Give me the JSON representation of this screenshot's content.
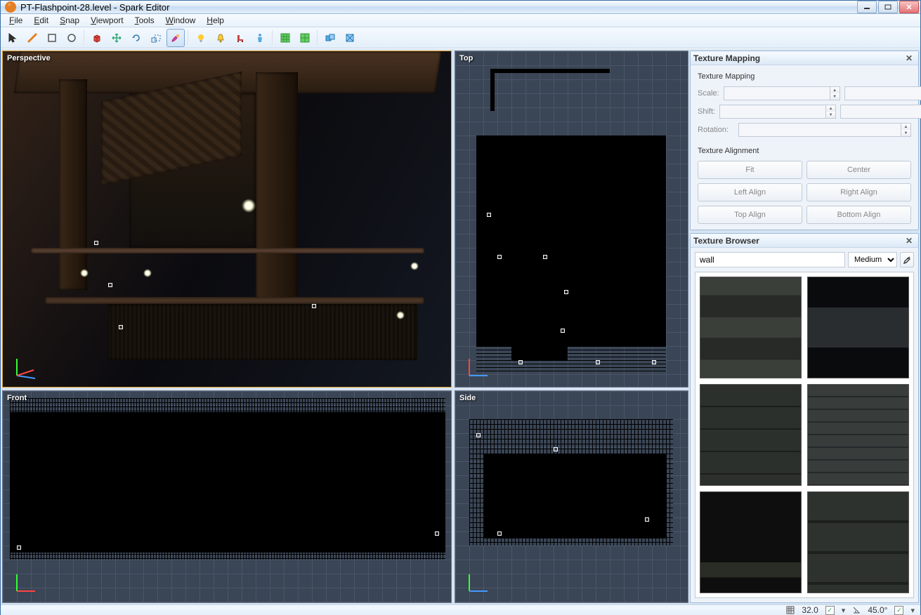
{
  "window": {
    "title": "PT-Flashpoint-28.level - Spark Editor"
  },
  "menu": [
    "File",
    "Edit",
    "Snap",
    "Viewport",
    "Tools",
    "Window",
    "Help"
  ],
  "toolbar": {
    "items": [
      {
        "name": "select-tool",
        "icon": "cursor"
      },
      {
        "name": "line-tool",
        "icon": "pencil"
      },
      {
        "name": "rect-tool",
        "icon": "rect"
      },
      {
        "name": "circle-tool",
        "icon": "circle"
      },
      {
        "name": "extrude-tool",
        "icon": "extrude"
      },
      {
        "name": "move-tool",
        "icon": "move"
      },
      {
        "name": "rotate-tool",
        "icon": "rotate"
      },
      {
        "name": "scale-tool",
        "icon": "scale"
      },
      {
        "name": "paint-tool",
        "icon": "paint",
        "active": true
      },
      {
        "name": "light-tool",
        "icon": "light"
      },
      {
        "name": "spawn-tool",
        "icon": "bell"
      },
      {
        "name": "prop-tool",
        "icon": "chair"
      },
      {
        "name": "player-tool",
        "icon": "player"
      },
      {
        "name": "grid-major",
        "icon": "gridA"
      },
      {
        "name": "grid-minor",
        "icon": "gridB"
      },
      {
        "name": "group-tool",
        "icon": "group"
      },
      {
        "name": "face-tool",
        "icon": "face"
      }
    ]
  },
  "viewports": {
    "perspective": {
      "label": "Perspective"
    },
    "top": {
      "label": "Top"
    },
    "front": {
      "label": "Front"
    },
    "side": {
      "label": "Side"
    }
  },
  "texture_mapping": {
    "title": "Texture Mapping",
    "group": "Texture Mapping",
    "scale_label": "Scale:",
    "shift_label": "Shift:",
    "rotation_label": "Rotation:",
    "align_group": "Texture Alignment",
    "buttons": {
      "fit": "Fit",
      "center": "Center",
      "left": "Left Align",
      "right": "Right Align",
      "top": "Top Align",
      "bottom": "Bottom Align"
    }
  },
  "texture_browser": {
    "title": "Texture Browser",
    "search": "wall",
    "size": "Medium",
    "thumbs": [
      {
        "c1": "#3a3f3a",
        "c2": "#272a27",
        "pattern": "panel"
      },
      {
        "c1": "#1a1c20",
        "c2": "#0a0b0d",
        "pattern": "band"
      },
      {
        "c1": "#2c302c",
        "c2": "#1b1e1b",
        "pattern": "tile"
      },
      {
        "c1": "#383c3a",
        "c2": "#24282a",
        "pattern": "brick"
      },
      {
        "c1": "#0e0e0e",
        "c2": "#2a2c26",
        "pattern": "band2"
      },
      {
        "c1": "#2e322e",
        "c2": "#1d201d",
        "pattern": "grid"
      }
    ]
  },
  "statusbar": {
    "grid_size": "32.0",
    "angle": "45.0°",
    "check1": true,
    "check2": true
  }
}
